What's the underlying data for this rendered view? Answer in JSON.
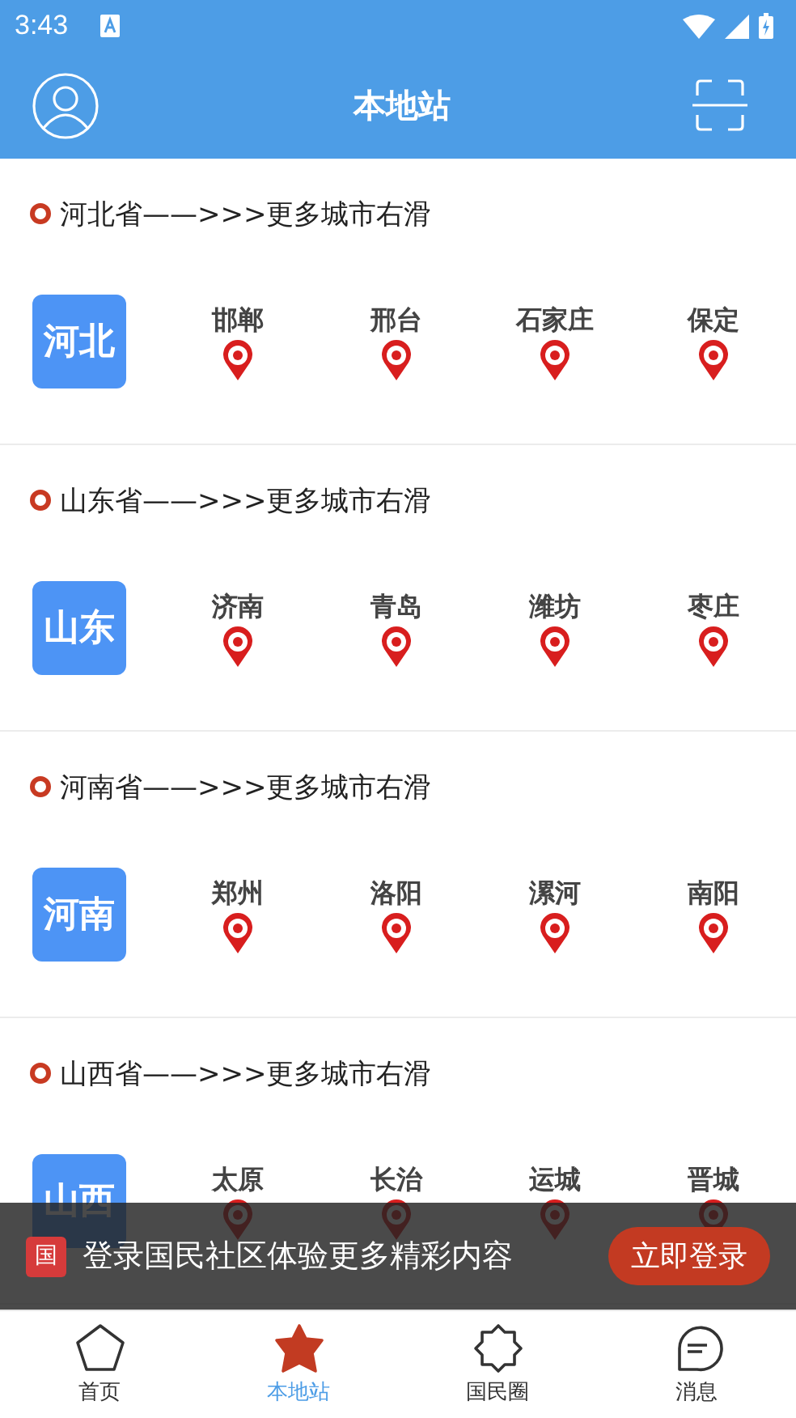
{
  "status_bar": {
    "time": "3:43"
  },
  "header": {
    "title": "本地站"
  },
  "provinces": [
    {
      "title": "河北省——>>>更多城市右滑",
      "badge": "河北",
      "cities": [
        "邯郸",
        "邢台",
        "石家庄",
        "保定"
      ]
    },
    {
      "title": "山东省——>>>更多城市右滑",
      "badge": "山东",
      "cities": [
        "济南",
        "青岛",
        "潍坊",
        "枣庄"
      ]
    },
    {
      "title": "河南省——>>>更多城市右滑",
      "badge": "河南",
      "cities": [
        "郑州",
        "洛阳",
        "漯河",
        "南阳"
      ]
    },
    {
      "title": "山西省——>>>更多城市右滑",
      "badge": "山西",
      "cities": [
        "太原",
        "长治",
        "运城",
        "晋城"
      ]
    }
  ],
  "login_banner": {
    "badge": "国",
    "text": "登录国民社区体验更多精彩内容",
    "button": "立即登录"
  },
  "tabs": [
    {
      "label": "首页",
      "selected": false
    },
    {
      "label": "本地站",
      "selected": true
    },
    {
      "label": "国民圈",
      "selected": false
    },
    {
      "label": "消息",
      "selected": false
    }
  ]
}
